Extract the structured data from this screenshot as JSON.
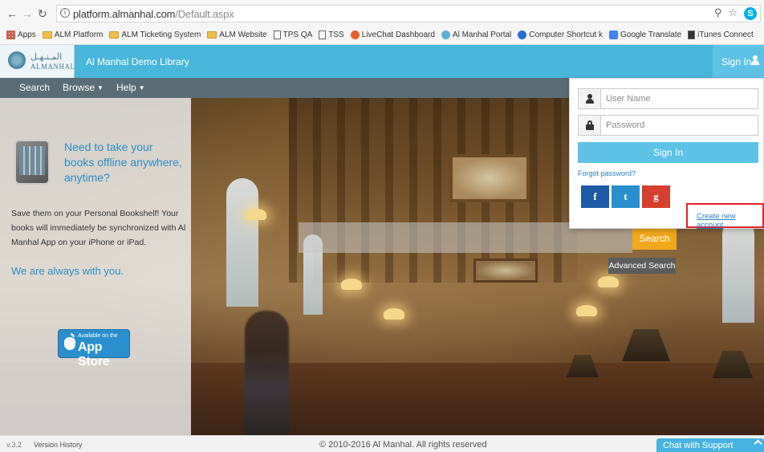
{
  "browser": {
    "url_host": "platform.almanhal.com",
    "url_path": "/Default.aspx",
    "bookmarks": [
      {
        "label": "Apps",
        "icon": "apps-icon"
      },
      {
        "label": "ALM Platform",
        "icon": "folder-icon"
      },
      {
        "label": "ALM Ticketing System",
        "icon": "folder-icon"
      },
      {
        "label": "ALM Website",
        "icon": "folder-icon"
      },
      {
        "label": "TPS QA",
        "icon": "page-icon"
      },
      {
        "label": "TSS",
        "icon": "page-icon"
      },
      {
        "label": "LiveChat Dashboard",
        "icon": "livechat-icon"
      },
      {
        "label": "Al Manhal Portal",
        "icon": "almanhal-icon"
      },
      {
        "label": "Computer Shortcut k",
        "icon": "chrome-icon"
      },
      {
        "label": "Google Translate",
        "icon": "translate-icon"
      },
      {
        "label": "iTunes Connect",
        "icon": "itunes-icon"
      }
    ]
  },
  "header": {
    "logo_arabic": "المـنـهـل",
    "logo_english": "ALMANHAL",
    "site_title": "Al Manhal Demo Library",
    "signin_label": "Sign In"
  },
  "nav": {
    "search": "Search",
    "browse": "Browse",
    "help": "Help"
  },
  "promo": {
    "title": "Need to take your books offline anywhere, anytime?",
    "body": "Save them on your Personal Bookshelf! Your books will immediately be synchronized with Al Manhal App on your iPhone or iPad.",
    "tagline": "We are always with you.",
    "appstore_small": "Available on the",
    "appstore_big": "App Store"
  },
  "search": {
    "placeholder": "",
    "button": "Search",
    "advanced": "Advanced Search"
  },
  "login": {
    "username_placeholder": "User Name",
    "password_placeholder": "Password",
    "signin_button": "Sign In",
    "forgot": "Forgot password?",
    "facebook": "f",
    "twitter": "t",
    "google": "g",
    "create_account": "Create new account"
  },
  "footer": {
    "version": "v.3.2",
    "version_history": "Version History",
    "copyright": "© 2010-2016 Al Manhal. All rights reserved",
    "chat": "Chat with Support"
  },
  "colors": {
    "header_blue": "#49b6db",
    "nav_gray": "#5a6d77",
    "search_orange": "#f1a81a",
    "facebook": "#1f5aa6",
    "twitter": "#2a8fcf",
    "google": "#d6402e",
    "highlight_red": "#e0242a"
  }
}
